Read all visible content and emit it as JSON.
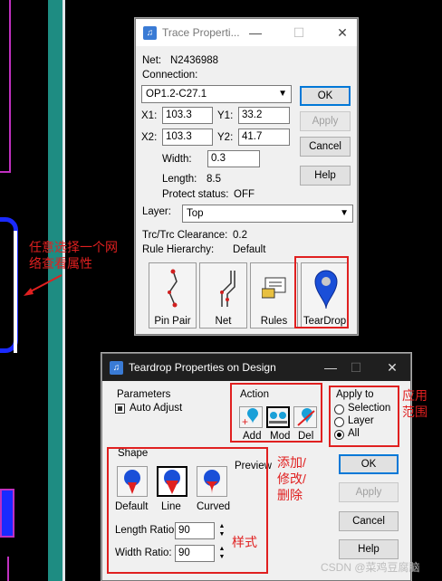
{
  "trace_window": {
    "title": "Trace Properti...",
    "net_label": "Net:",
    "net_value": "N2436988",
    "connection_label": "Connection:",
    "connection_value": "OP1.2-C27.1",
    "x1_label": "X1:",
    "x1_value": "103.3",
    "y1_label": "Y1:",
    "y1_value": "33.2",
    "x2_label": "X2:",
    "x2_value": "103.3",
    "y2_label": "Y2:",
    "y2_value": "41.7",
    "width_label": "Width:",
    "width_value": "0.3",
    "length_label": "Length:",
    "length_value": "8.5",
    "protect_label": "Protect status:",
    "protect_value": "OFF",
    "layer_label": "Layer:",
    "layer_value": "Top",
    "clearance_label": "Trc/Trc Clearance:",
    "clearance_value": "0.2",
    "rule_label": "Rule Hierarchy:",
    "rule_value": "Default",
    "buttons": {
      "ok": "OK",
      "apply": "Apply",
      "cancel": "Cancel",
      "help": "Help"
    },
    "big_buttons": {
      "pinpair": "Pin Pair",
      "net": "Net",
      "rules": "Rules",
      "teardrop": "TearDrop"
    }
  },
  "teardrop_window": {
    "title": "Teardrop Properties on Design",
    "parameters_label": "Parameters",
    "auto_adjust_label": "Auto Adjust",
    "action_label": "Action",
    "action_buttons": {
      "add": "Add",
      "mod": "Mod",
      "del": "Del"
    },
    "apply_to_label": "Apply to",
    "apply_options": [
      "Selection",
      "Layer",
      "All"
    ],
    "apply_selected": "All",
    "shape_label": "Shape",
    "preview_label": "Preview",
    "shapes": {
      "default": "Default",
      "line": "Line",
      "curved": "Curved"
    },
    "length_ratio_label": "Length Ratio:",
    "length_ratio_value": "90",
    "width_ratio_label": "Width Ratio:",
    "width_ratio_value": "90",
    "buttons": {
      "ok": "OK",
      "apply": "Apply",
      "cancel": "Cancel",
      "help": "Help"
    }
  },
  "annotations": {
    "select_network": "任意选择一个网络查看属性",
    "apply_scope": "应用范围",
    "add_mod_del": "添加/修改/删除",
    "style": "样式"
  },
  "watermark": "CSDN @菜鸡豆腐脑",
  "colors": {
    "accent": "#0078d7",
    "annotation_red": "#e02020",
    "teardrop_blue": "#1a4fd8",
    "teardrop_red": "#e02020"
  }
}
